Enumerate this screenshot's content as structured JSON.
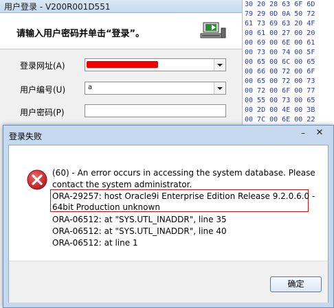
{
  "hex_viewer": {
    "rows": [
      "30 20 28 63 6F 6D",
      "79 29 0D 0A 50 72",
      "61 73 69 63 20 4F",
      "00 61 00 27 00 20",
      "00 69 00 6E 00 61",
      "00 73 00 74 00 5F",
      "00 65 00 6C 00 65",
      "00 66 00 72 00 6F",
      "00 65 00 72 00 73",
      "00 72 00 6F 00 77",
      "00 55 00 73 00 65",
      "00 2D 00 4E 00 3B",
      "00 7C 00 6E 00 22"
    ]
  },
  "login_window": {
    "title": "用户登录 - V200R001D551",
    "instruction": "请输入用户密码并单击“登录”。",
    "fields": {
      "url_label": "登录网址(A)",
      "user_label": "用户编号(U)",
      "user_value": "a",
      "password_label": "用户密码(P)"
    },
    "icon": "login-computer-icon"
  },
  "error_dialog": {
    "title": "登录失败",
    "icon": "error-icon",
    "message_lines": [
      "(60) - An error occurs in accessing the system database. Please",
      "contact the system administrator.",
      "ORA-29257: host Oracle9i Enterprise Edition Release 9.2.0.6.0 -",
      "64bit Production unknown",
      "ORA-06512: at \"SYS.UTL_INADDR\", line 35",
      "ORA-06512: at \"SYS.UTL_INADDR\", line 40",
      "ORA-06512: at line 1"
    ],
    "ok_label": "确定",
    "highlight_color": "#d01010",
    "error_icon_color": "#c8252b"
  }
}
